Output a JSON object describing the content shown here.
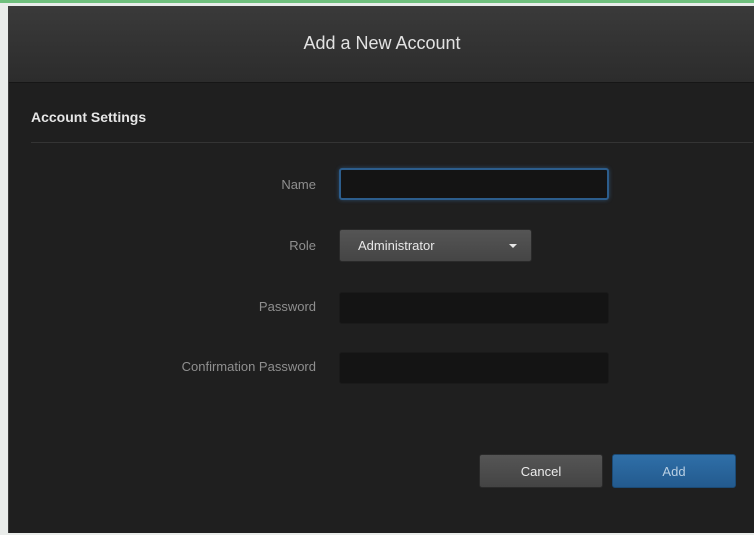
{
  "dialog": {
    "title": "Add a New Account",
    "section_title": "Account Settings"
  },
  "form": {
    "name_label": "Name",
    "name_value": "",
    "role_label": "Role",
    "role_value": "Administrator",
    "password_label": "Password",
    "password_value": "",
    "confirm_label": "Confirmation Password",
    "confirm_value": ""
  },
  "buttons": {
    "cancel": "Cancel",
    "add": "Add"
  },
  "colors": {
    "accent_strip": "#6fbf7d",
    "primary_button": "#2f6fa8",
    "focus_border": "#2c5d8c"
  },
  "icons": {
    "role_dropdown": "caret-down-icon"
  }
}
